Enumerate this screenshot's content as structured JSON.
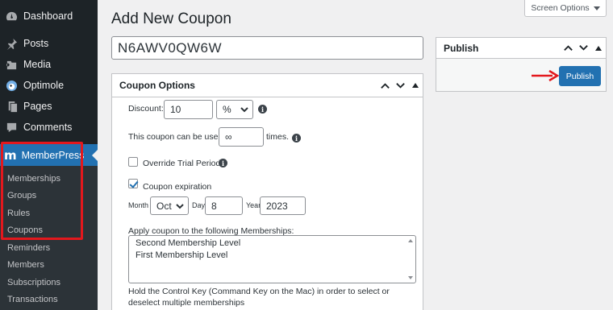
{
  "sidebar": {
    "items": [
      {
        "label": "Dashboard",
        "icon": "dashboard-icon"
      },
      {
        "label": "Posts",
        "icon": "pin-icon"
      },
      {
        "label": "Media",
        "icon": "media-icon"
      },
      {
        "label": "Optimole",
        "icon": "optimole-icon"
      },
      {
        "label": "Pages",
        "icon": "pages-icon"
      },
      {
        "label": "Comments",
        "icon": "comments-icon"
      }
    ],
    "active": {
      "label": "MemberPress",
      "logo": "m",
      "icon": "memberpress-logo-icon"
    },
    "submenu": [
      "Memberships",
      "Groups",
      "Rules",
      "Coupons",
      "Reminders",
      "Members",
      "Subscriptions",
      "Transactions"
    ]
  },
  "header": {
    "title": "Add New Coupon",
    "screen_options": "Screen Options"
  },
  "coupon": {
    "code": "N6AWV0QW6W"
  },
  "options_box": {
    "title": "Coupon Options",
    "discount_label": "Discount:",
    "discount_value": "10",
    "discount_type": "%",
    "usage_label": "This coupon can be used",
    "usage_value": "∞",
    "usage_suffix": "times.",
    "override_label": "Override Trial Period",
    "override_checked": false,
    "expiration_label": "Coupon expiration",
    "expiration_checked": true,
    "month_label": "Month",
    "month_value": "Oct",
    "day_label": "Day",
    "day_value": "8",
    "year_label": "Year",
    "year_value": "2023",
    "apply_label": "Apply coupon to the following Memberships:",
    "memberships": [
      "Second Membership Level",
      "First Membership Level"
    ],
    "hint": "Hold the Control Key (Command Key on the Mac) in order to select or deselect multiple memberships"
  },
  "publish_box": {
    "title": "Publish",
    "button": "Publish"
  },
  "colors": {
    "sidebar_bg": "#1d2327",
    "accent": "#2271b1",
    "highlight": "#e3181d"
  }
}
